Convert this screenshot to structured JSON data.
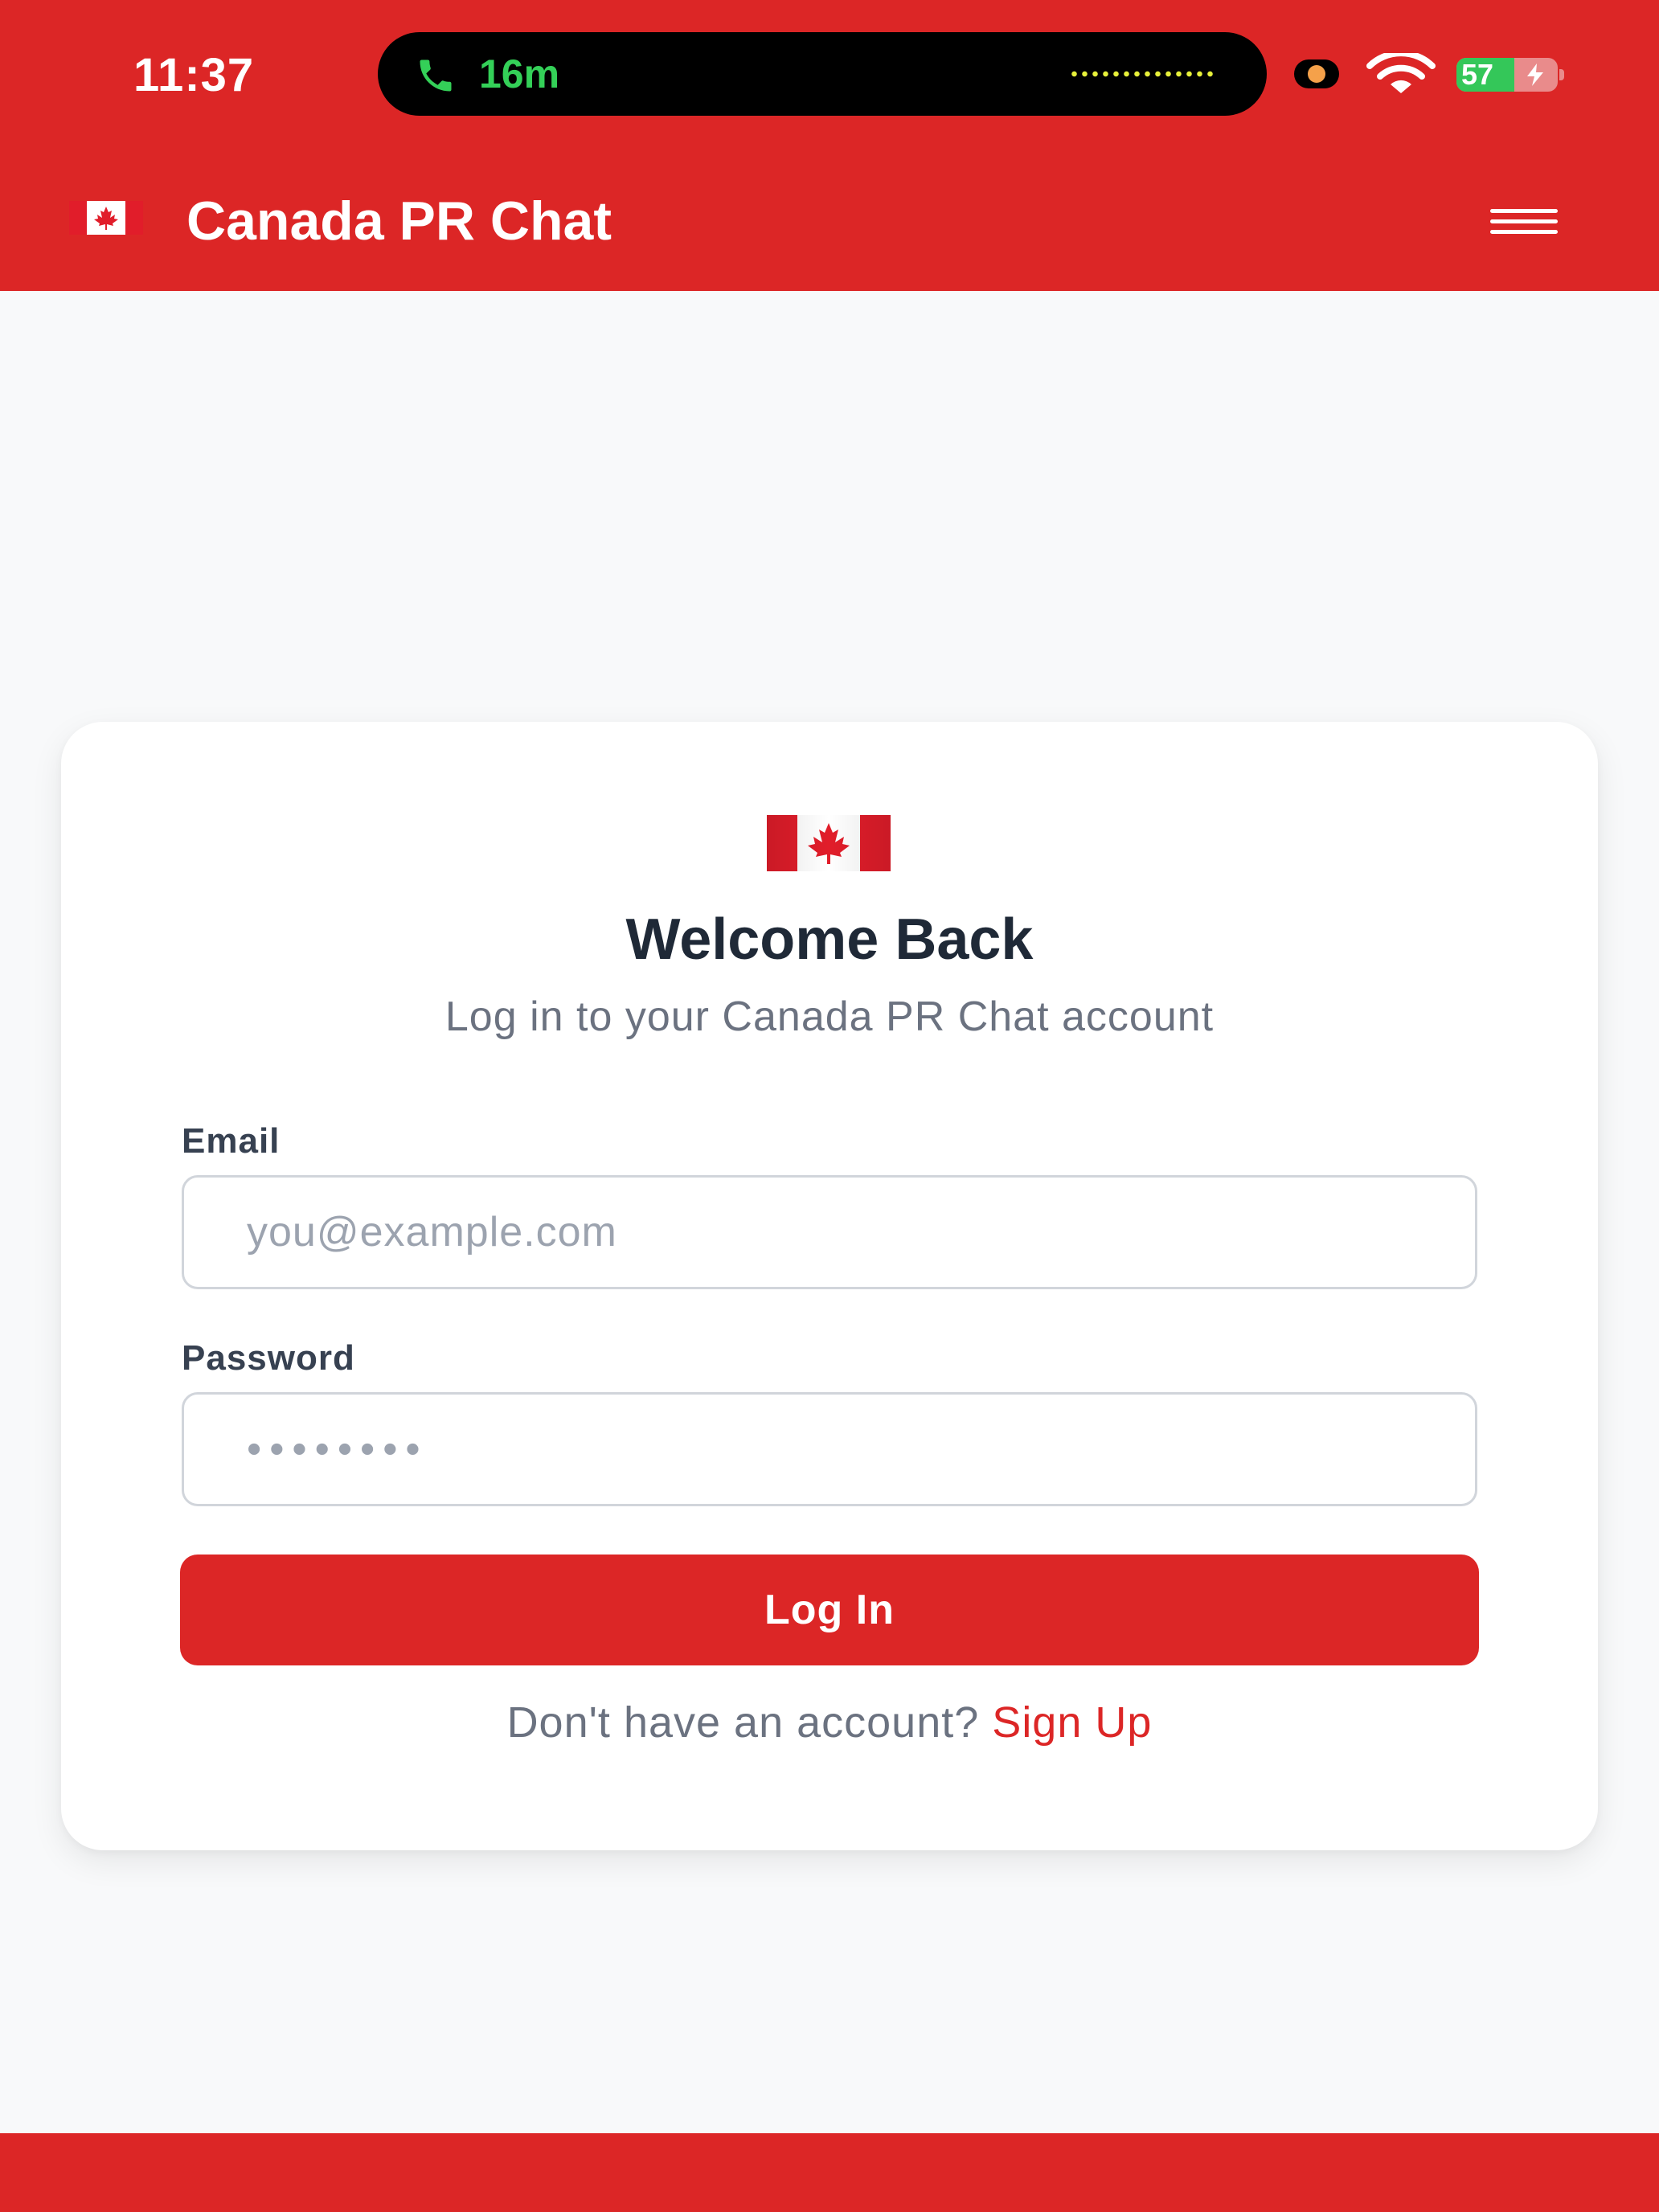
{
  "status_bar": {
    "time": "11:37",
    "call_duration": "16m",
    "battery_percent": "57",
    "battery_level": 0.57,
    "icons": {
      "call": "phone-icon",
      "recording": "privacy-indicator-dot",
      "wifi": "wifi-icon",
      "battery": "battery-charging-icon"
    }
  },
  "header": {
    "title": "Canada PR Chat",
    "flag_icon": "canada-flag-icon",
    "menu_icon": "hamburger-menu-icon"
  },
  "login_card": {
    "flag_icon": "canada-flag-icon",
    "title": "Welcome Back",
    "subtitle": "Log in to your Canada PR Chat account",
    "email": {
      "label": "Email",
      "value": "",
      "placeholder": "you@example.com"
    },
    "password": {
      "label": "Password",
      "value": "",
      "placeholder": "••••••••"
    },
    "submit_label": "Log In",
    "signup_prompt": "Don't have an account?",
    "signup_link": "Sign Up"
  },
  "colors": {
    "brand_red": "#dc2626",
    "page_background": "#f8f9fa",
    "card_background": "#ffffff",
    "title_text": "#1f2937",
    "muted_text": "#6b7280",
    "call_green": "#34d058",
    "battery_green": "#34c759"
  }
}
